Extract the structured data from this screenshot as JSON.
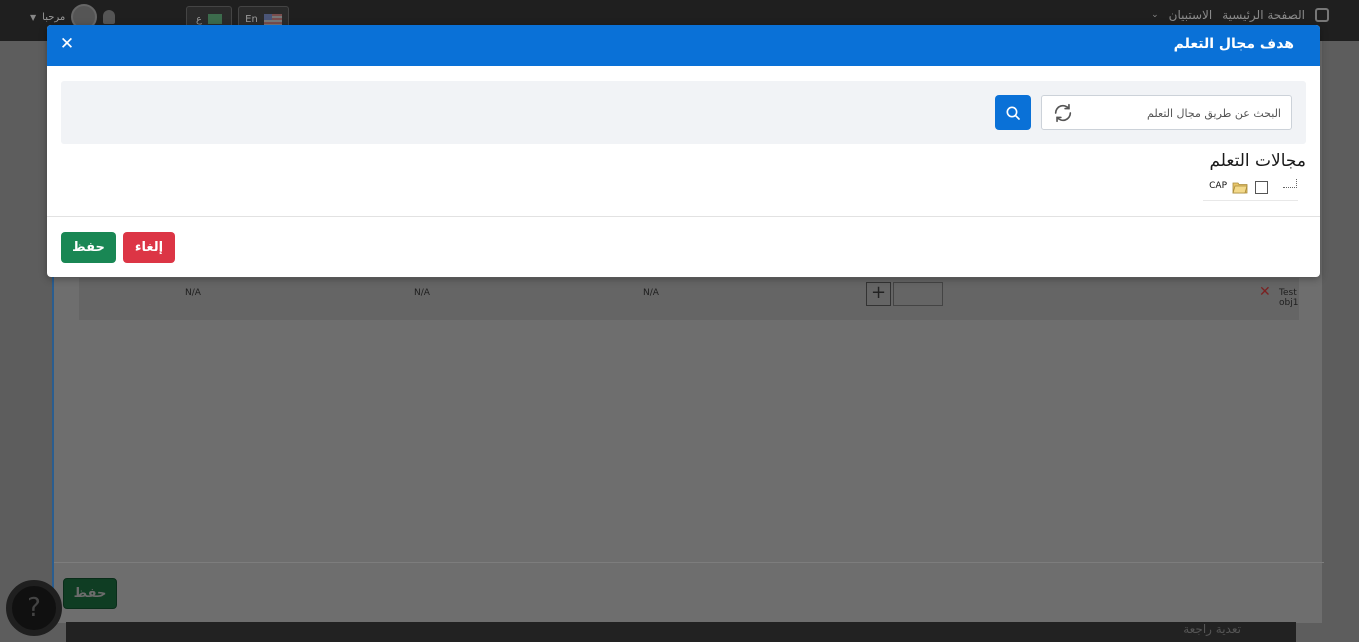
{
  "topbar": {
    "home_label": "الصفحة الرئيسية",
    "survey_label": "الاستبيان",
    "lang_ar": "ع",
    "lang_en": "En",
    "greeting": "مرحبا"
  },
  "background": {
    "row_cells": [
      "N/A",
      "N/A",
      "N/A"
    ],
    "row_name": "Test obj1",
    "save_label": "حفظ",
    "help_glyph": "?",
    "bottom_text": "تعدية راجعة"
  },
  "modal": {
    "title": "هدف مجال التعلم",
    "search": {
      "placeholder": "البحث عن طريق مجال التعلم",
      "value": ""
    },
    "section_title": "مجالات التعلم",
    "tree": [
      {
        "label": "CAP",
        "checked": false
      }
    ],
    "cancel_label": "إلغاء",
    "save_label": "حفظ"
  },
  "colors": {
    "header": "#0a71d7",
    "save": "#198754",
    "cancel": "#dc3545"
  }
}
